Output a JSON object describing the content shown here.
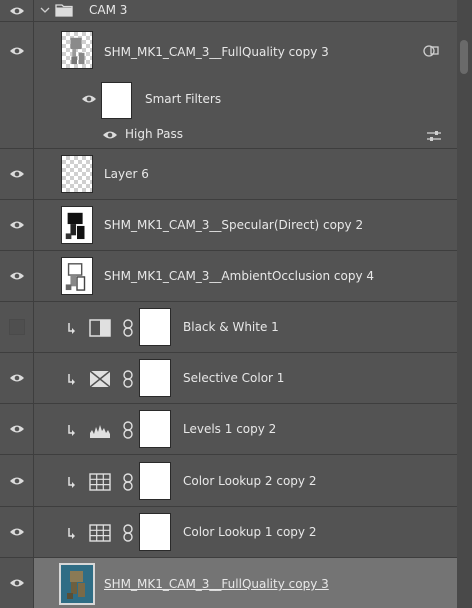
{
  "group": {
    "name": "CAM 3"
  },
  "layers": [
    {
      "name": "SHM_MK1_CAM_3__FullQuality copy 3"
    },
    {
      "name": "Smart Filters"
    },
    {
      "name": "High Pass"
    },
    {
      "name": "Layer 6"
    },
    {
      "name": "SHM_MK1_CAM_3__Specular(Direct) copy 2"
    },
    {
      "name": "SHM_MK1_CAM_3__AmbientOcclusion copy 4"
    },
    {
      "name": "Black & White 1"
    },
    {
      "name": "Selective Color 1"
    },
    {
      "name": "Levels 1 copy 2"
    },
    {
      "name": "Color Lookup 2 copy 2"
    },
    {
      "name": "Color Lookup 1 copy 2"
    },
    {
      "name": "SHM_MK1_CAM_3__FullQuality copy 3"
    }
  ],
  "colors": {
    "panel": "#535353",
    "selected": "#747474",
    "divider": "#3e3e3e"
  }
}
